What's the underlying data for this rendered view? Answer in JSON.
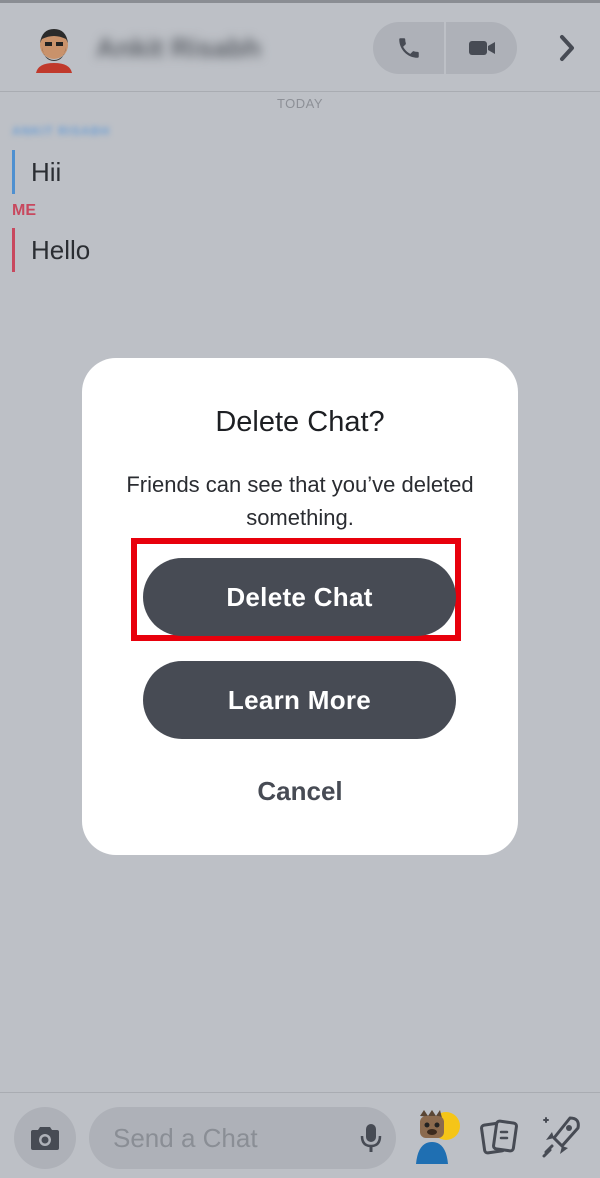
{
  "header": {
    "contact_name": "Ankit Risabh",
    "icons": [
      "avatar",
      "phone-icon",
      "video-icon",
      "chevron-right-icon"
    ]
  },
  "chat": {
    "day_label": "TODAY",
    "messages": [
      {
        "sender": "ANKIT RISABH",
        "text": "Hii"
      },
      {
        "sender": "ME",
        "text": "Hello"
      }
    ]
  },
  "dialog": {
    "title": "Delete Chat?",
    "message": "Friends can see that you’ve deleted something.",
    "delete_label": "Delete Chat",
    "learn_more_label": "Learn More",
    "cancel_label": "Cancel"
  },
  "composer": {
    "placeholder": "Send a Chat",
    "icons": [
      "camera-icon",
      "mic-icon",
      "bitmoji-icon",
      "cards-icon",
      "rocket-icon"
    ]
  },
  "colors": {
    "overlay_bg": "#bdc0c6",
    "button_dark": "#474b54",
    "highlight_red": "#e8000c",
    "friend_accent": "#4f90d0",
    "me_accent": "#c8485e"
  }
}
